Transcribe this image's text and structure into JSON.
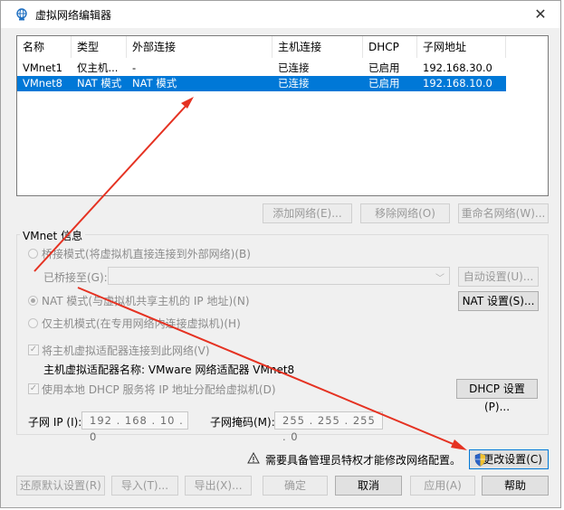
{
  "window": {
    "title": "虚拟网络编辑器",
    "close_glyph": "✕"
  },
  "networks": {
    "columns": [
      "名称",
      "类型",
      "外部连接",
      "主机连接",
      "DHCP",
      "子网地址"
    ],
    "rows": [
      {
        "name": "VMnet1",
        "type": "仅主机...",
        "external": "-",
        "host": "已连接",
        "dhcp": "已启用",
        "subnet": "192.168.30.0",
        "selected": false
      },
      {
        "name": "VMnet8",
        "type": "NAT 模式",
        "external": "NAT 模式",
        "host": "已连接",
        "dhcp": "已启用",
        "subnet": "192.168.10.0",
        "selected": true
      }
    ]
  },
  "list_buttons": {
    "add": "添加网络(E)...",
    "remove": "移除网络(O)",
    "rename": "重命名网络(W)..."
  },
  "vmnet_info": {
    "group_label": "VMnet 信息",
    "bridged_label": "桥接模式(将虚拟机直接连接到外部网络)(B)",
    "bridged_to_label": "已桥接至(G):",
    "auto_settings": "自动设置(U)...",
    "nat_label": "NAT 模式(与虚拟机共享主机的 IP 地址)(N)",
    "nat_settings": "NAT 设置(S)...",
    "hostonly_label": "仅主机模式(在专用网络内连接虚拟机)(H)",
    "connect_adapter_label": "将主机虚拟适配器连接到此网络(V)",
    "adapter_name_label": "主机虚拟适配器名称: VMware 网络适配器 VMnet8",
    "use_dhcp_label": "使用本地 DHCP 服务将 IP 地址分配给虚拟机(D)",
    "dhcp_settings": "DHCP 设置(P)...",
    "subnet_ip_label": "子网 IP (I):",
    "subnet_ip_value": "192 . 168 . 10 . 0",
    "subnet_mask_label": "子网掩码(M):",
    "subnet_mask_value": "255 . 255 . 255 . 0"
  },
  "admin_notice": {
    "text": "需要具备管理员特权才能修改网络配置。",
    "change_settings": "更改设置(C)"
  },
  "footer_buttons": {
    "restore_defaults": "还原默认设置(R)",
    "import": "导入(T)...",
    "export": "导出(X)...",
    "ok": "确定",
    "cancel": "取消",
    "apply": "应用(A)",
    "help": "帮助"
  },
  "colors": {
    "selection": "#0078d7",
    "annotation_arrow": "#e53222",
    "window_bg": "#f0f0f0"
  }
}
